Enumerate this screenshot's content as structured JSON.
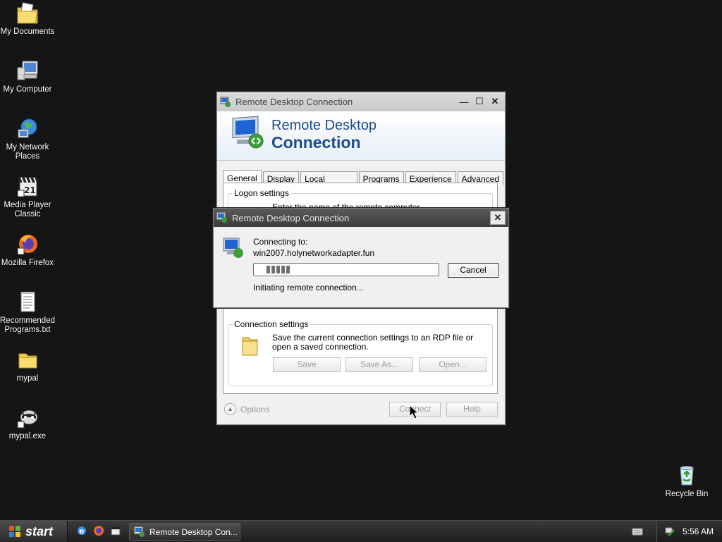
{
  "desktop": {
    "icons": [
      {
        "label": "My Documents"
      },
      {
        "label": "My Computer"
      },
      {
        "label": "My Network Places"
      },
      {
        "label": "Media Player Classic"
      },
      {
        "label": "Mozilla Firefox"
      },
      {
        "label": "Recommended Programs.txt"
      },
      {
        "label": "mypal"
      },
      {
        "label": "mypal.exe"
      },
      {
        "label": "Recycle Bin"
      }
    ]
  },
  "main_window": {
    "title": "Remote Desktop Connection",
    "banner_line1": "Remote Desktop",
    "banner_line2": "Connection",
    "tabs": [
      {
        "label": "General"
      },
      {
        "label": "Display"
      },
      {
        "label": "Local Resources"
      },
      {
        "label": "Programs"
      },
      {
        "label": "Experience"
      },
      {
        "label": "Advanced"
      }
    ],
    "logon_settings_title": "Logon settings",
    "logon_partial_text": "Enter the name of the remote computer.",
    "connection_settings_title": "Connection settings",
    "connection_settings_text": "Save the current connection settings to an RDP file or open a saved connection.",
    "save_label": "Save",
    "save_as_label": "Save As...",
    "open_label": "Open...",
    "options_label": "Options",
    "connect_label": "Connect",
    "help_label": "Help"
  },
  "connecting_dialog": {
    "title": "Remote Desktop Connection",
    "connecting_to_label": "Connecting to:",
    "host": "win2007.holynetworkadapter.fun",
    "cancel_label": "Cancel",
    "status": "Initiating remote connection...",
    "progress_chunks": 5
  },
  "taskbar": {
    "start_label": "start",
    "task_label": "Remote Desktop Con...",
    "clock": "5:56 AM"
  }
}
